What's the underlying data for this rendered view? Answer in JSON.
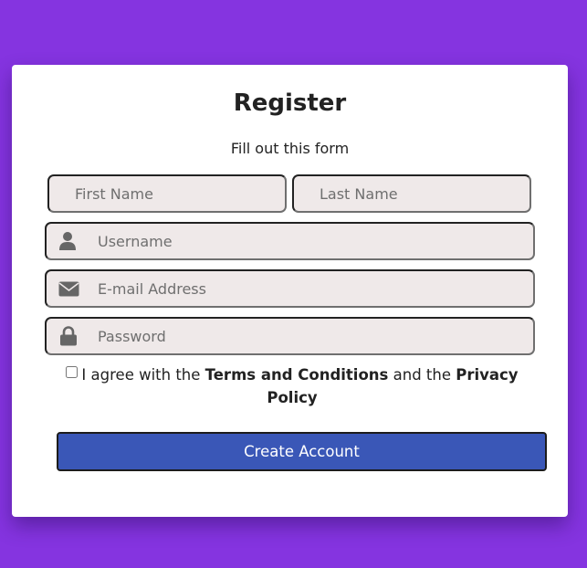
{
  "form": {
    "title": "Register",
    "subtitle": "Fill out this form",
    "first_name_placeholder": "First Name",
    "last_name_placeholder": "Last Name",
    "username_placeholder": "Username",
    "email_placeholder": "E-mail Address",
    "password_placeholder": "Password",
    "agree_prefix": "I agree with the",
    "terms_label": "Terms and Conditions",
    "agree_middle": "and the",
    "privacy_label": "Privacy Policy",
    "submit_label": "Create Account",
    "icons": {
      "username": "user-icon",
      "email": "envelope-icon",
      "password": "lock-icon"
    },
    "colors": {
      "background": "#8534e0",
      "card": "#ffffff",
      "field": "#efe9e9",
      "button": "#3a57b7"
    }
  }
}
